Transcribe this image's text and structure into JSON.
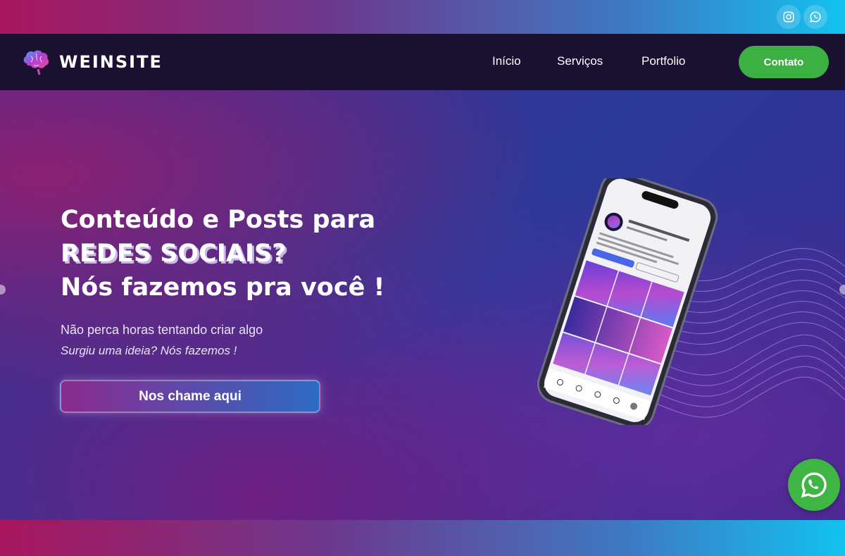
{
  "topbar": {
    "social": [
      {
        "icon": "instagram-icon"
      },
      {
        "icon": "whatsapp-icon"
      }
    ]
  },
  "navbar": {
    "brand": "WEINSITE",
    "links": [
      "Início",
      "Serviços",
      "Portfolio"
    ],
    "cta_label": "Contato"
  },
  "hero": {
    "headline_line1": "Conteúdo e Posts para",
    "headline_line2": "REDES SOCIAIS?",
    "headline_line3": "Nós fazemos pra você !",
    "subtitle": "Não perca horas tentando criar algo",
    "subtitle_italic": "Surgiu uma ideia? Nós fazemos !",
    "cta_label": "Nos chame aqui"
  },
  "floating": {
    "icon": "whatsapp-icon"
  },
  "colors": {
    "accent_green": "#3cb043",
    "nav_bg": "#1a1030",
    "gradient_start": "#a8165e",
    "gradient_end": "#12c2f0"
  }
}
